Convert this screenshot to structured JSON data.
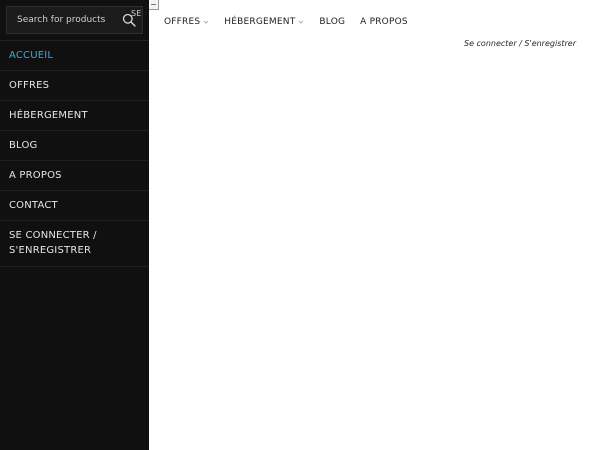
{
  "search": {
    "placeholder": "Search for products",
    "overflow_label": "SE"
  },
  "sidebar": {
    "items": [
      {
        "label": "ACCUEIL",
        "active": true
      },
      {
        "label": "OFFRES"
      },
      {
        "label": "HÉBERGEMENT"
      },
      {
        "label": "BLOG"
      },
      {
        "label": "A PROPOS"
      },
      {
        "label": "CONTACT"
      },
      {
        "label_line1": "SE CONNECTER /",
        "label_line2": "S'ENREGISTRER"
      }
    ]
  },
  "topnav": {
    "items": [
      {
        "label": "OFFRES",
        "has_dropdown": true
      },
      {
        "label": "HÉBERGEMENT",
        "has_dropdown": true
      },
      {
        "label": "BLOG",
        "has_dropdown": false
      },
      {
        "label": "A PROPOS",
        "has_dropdown": false
      }
    ]
  },
  "account": {
    "link": "Se connecter / S'enregistrer"
  },
  "colors": {
    "sidebar_bg": "#101010",
    "active_accent": "#3fa9d6",
    "text_light": "#e6e6e6",
    "text_dark": "#1e1e1e"
  },
  "icons": [
    "search-icon",
    "chevron-down-icon",
    "broken-image-icon"
  ]
}
